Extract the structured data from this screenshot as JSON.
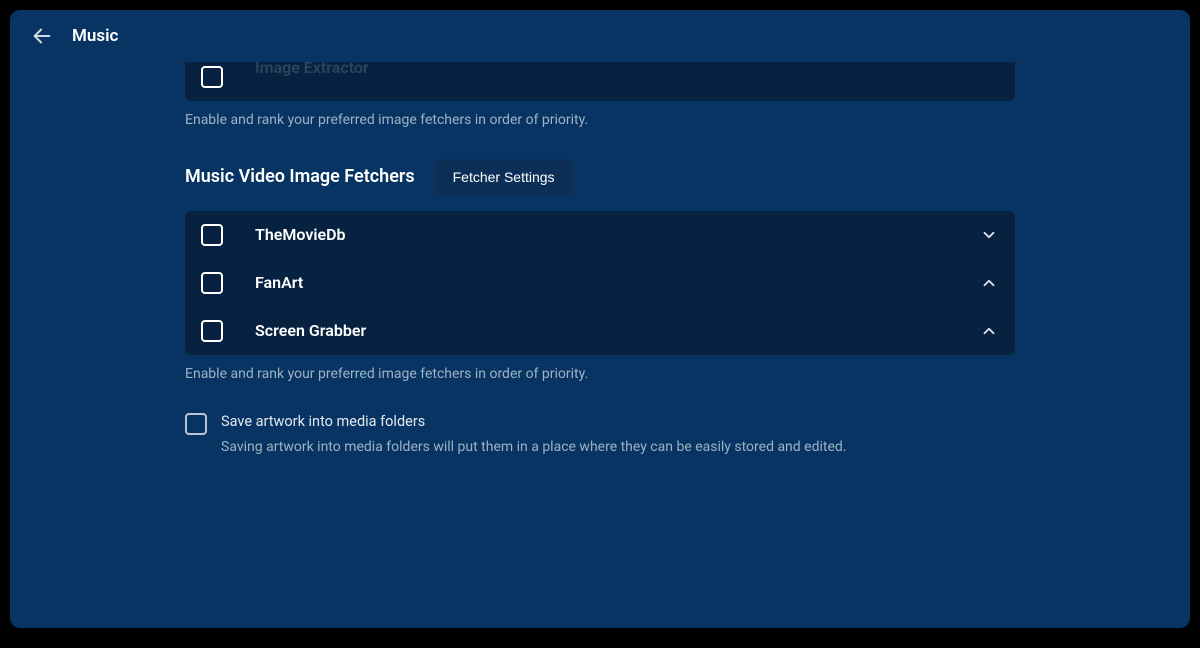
{
  "header": {
    "title": "Music"
  },
  "partialRow": {
    "label": "Image Extractor"
  },
  "helpText1": "Enable and rank your preferred image fetchers in order of priority.",
  "section": {
    "title": "Music Video Image Fetchers",
    "fetcherSettingsLabel": "Fetcher Settings"
  },
  "fetchers": [
    {
      "label": "TheMovieDb",
      "canMoveDown": true,
      "canMoveUp": false
    },
    {
      "label": "FanArt",
      "canMoveDown": false,
      "canMoveUp": true
    },
    {
      "label": "Screen Grabber",
      "canMoveDown": false,
      "canMoveUp": true
    }
  ],
  "helpText2": "Enable and rank your preferred image fetchers in order of priority.",
  "saveArtwork": {
    "label": "Save artwork into media folders",
    "description": "Saving artwork into media folders will put them in a place where they can be easily stored and edited."
  }
}
